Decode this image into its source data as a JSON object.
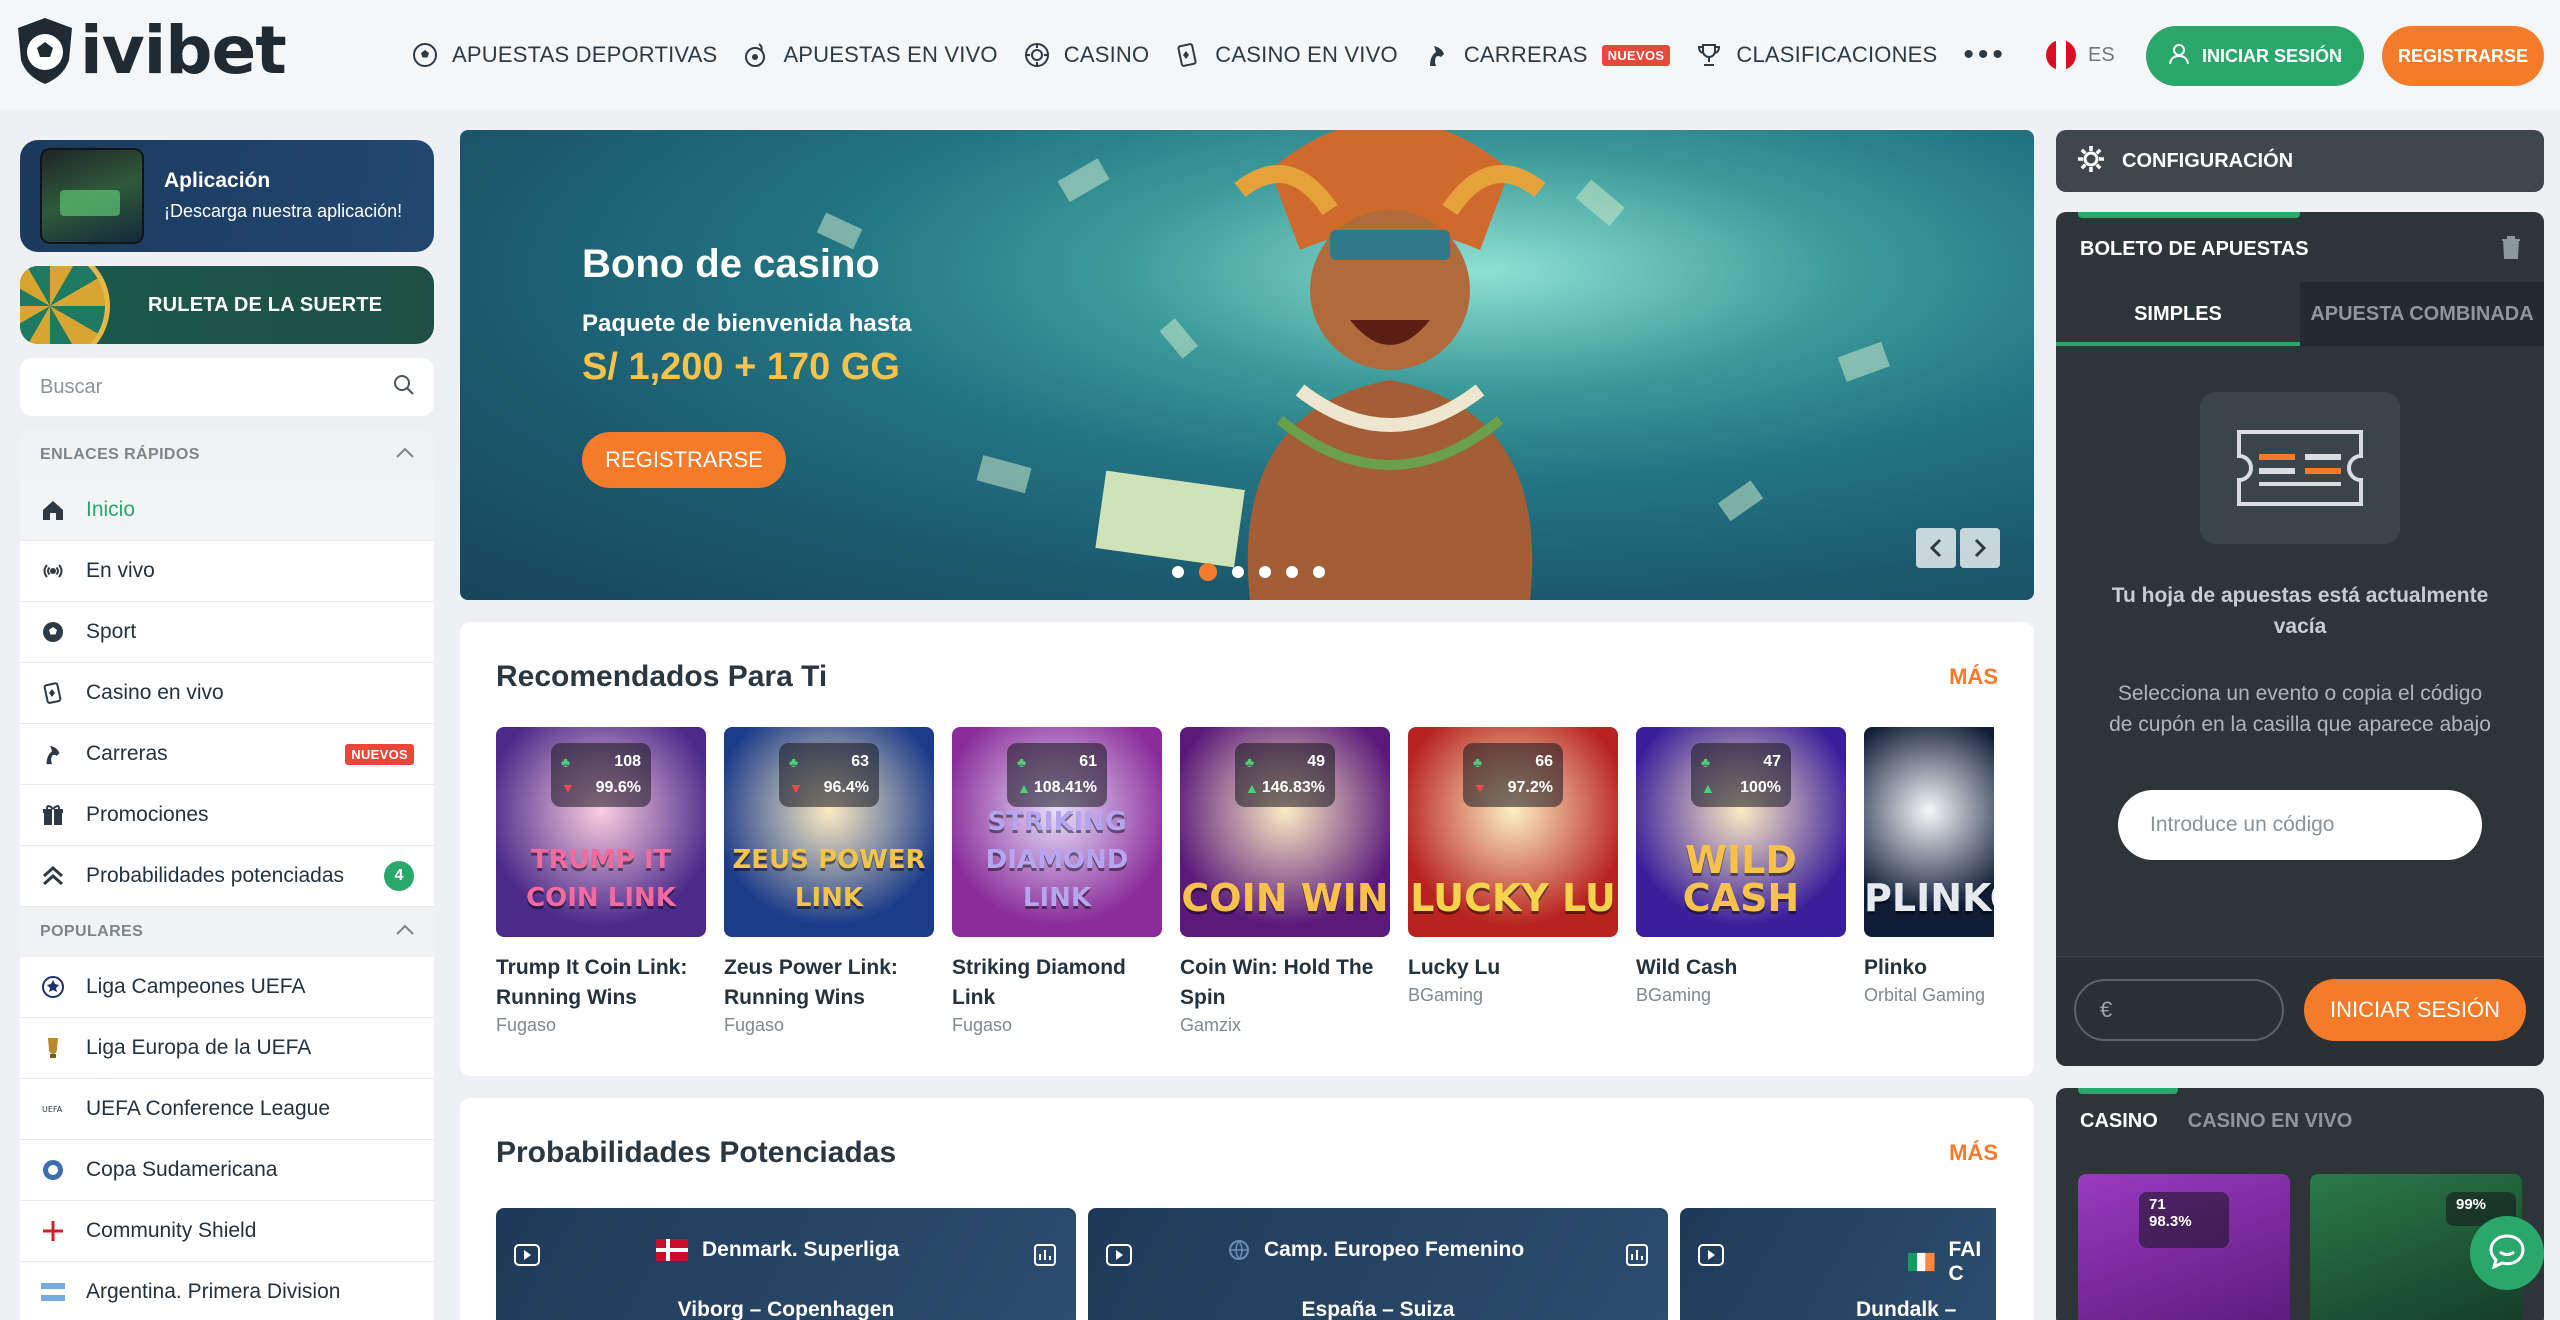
{
  "brand": {
    "name": "ivibet"
  },
  "colors": {
    "green": "#2aa86c",
    "orange": "#f47b29",
    "badge_red": "#e9473a"
  },
  "nav": {
    "items": [
      {
        "label": "APUESTAS DEPORTIVAS",
        "icon": "soccer-ball-icon"
      },
      {
        "label": "APUESTAS EN VIVO",
        "icon": "live-ball-icon"
      },
      {
        "label": "CASINO",
        "icon": "casino-chip-icon"
      },
      {
        "label": "CASINO EN VIVO",
        "icon": "live-casino-icon"
      },
      {
        "label": "CARRERAS",
        "icon": "horse-icon",
        "badge": "NUEVOS"
      },
      {
        "label": "CLASIFICACIONES",
        "icon": "trophy-icon"
      }
    ],
    "more": "•••"
  },
  "header": {
    "lang": "ES",
    "login": "INICIAR SESIÓN",
    "register": "REGISTRARSE"
  },
  "sidebar": {
    "app": {
      "title": "Aplicación",
      "subtitle": "¡Descarga nuestra aplicación!"
    },
    "wheel": "RULETA DE LA SUERTE",
    "search_placeholder": "Buscar",
    "quick_links": {
      "title": "ENLACES RÁPIDOS",
      "items": [
        {
          "label": "Inicio",
          "icon": "home-icon",
          "active": true
        },
        {
          "label": "En vivo",
          "icon": "live-signal-icon"
        },
        {
          "label": "Sport",
          "icon": "soccer-ball-icon"
        },
        {
          "label": "Casino en vivo",
          "icon": "live-casino-icon"
        },
        {
          "label": "Carreras",
          "icon": "horse-icon",
          "badge": "NUEVOS"
        },
        {
          "label": "Promociones",
          "icon": "gift-icon"
        },
        {
          "label": "Probabilidades potenciadas",
          "icon": "boost-icon",
          "count": "4"
        }
      ]
    },
    "popular": {
      "title": "POPULARES",
      "items": [
        {
          "label": "Liga Campeones UEFA",
          "icon": "champions-league-icon"
        },
        {
          "label": "Liga Europa de la UEFA",
          "icon": "europa-league-icon"
        },
        {
          "label": "UEFA Conference League",
          "icon": "conference-league-icon"
        },
        {
          "label": "Copa Sudamericana",
          "icon": "sudamericana-icon"
        },
        {
          "label": "Community Shield",
          "icon": "england-flag-icon"
        },
        {
          "label": "Argentina. Primera Division",
          "icon": "argentina-flag-icon"
        }
      ]
    }
  },
  "banner": {
    "title": "Bono de casino",
    "subtitle": "Paquete de bienvenida hasta",
    "amount": "S/ 1,200 + 170 GG",
    "button": "REGISTRARSE",
    "slides": 6,
    "active_slide": 2
  },
  "recommended": {
    "title": "Recomendados Para Ti",
    "more": "MÁS",
    "games": [
      {
        "name": "Trump It Coin Link: Running Wins",
        "provider": "Fugaso",
        "players": "108",
        "rtp": "99.6%",
        "rtp_dir": "down",
        "art": "TRUMP IT COIN LINK",
        "bg": "#4b2a8a",
        "accent": "#f26aa0"
      },
      {
        "name": "Zeus Power Link: Running Wins",
        "provider": "Fugaso",
        "players": "63",
        "rtp": "96.4%",
        "rtp_dir": "down",
        "art": "ZEUS POWER LINK",
        "bg": "#1c3c8a",
        "accent": "#f3c44a"
      },
      {
        "name": "Striking Diamond Link",
        "provider": "Fugaso",
        "players": "61",
        "rtp": "108.41%",
        "rtp_dir": "up",
        "art": "STRIKING DIAMOND LINK",
        "bg": "#8a2c9a",
        "accent": "#b6a6f0"
      },
      {
        "name": "Coin Win: Hold The Spin",
        "provider": "Gamzix",
        "players": "49",
        "rtp": "146.83%",
        "rtp_dir": "up",
        "art": "COIN WIN",
        "bg": "#5a1a7a",
        "accent": "#f6c24c"
      },
      {
        "name": "Lucky Lu",
        "provider": "BGaming",
        "players": "66",
        "rtp": "97.2%",
        "rtp_dir": "down",
        "art": "LUCKY LU",
        "bg": "#b8231f",
        "accent": "#f6d34c"
      },
      {
        "name": "Wild Cash",
        "provider": "BGaming",
        "players": "47",
        "rtp": "100%",
        "rtp_dir": "up",
        "art": "WILD CASH",
        "bg": "#3a1f9a",
        "accent": "#f6c24c"
      },
      {
        "name": "Plinko",
        "provider": "Orbital Gaming",
        "players": "",
        "rtp": "",
        "rtp_dir": "up",
        "art": "PLINKO",
        "bg": "#101c36",
        "accent": "#e6e9ee"
      }
    ]
  },
  "boosted": {
    "title": "Probabilidades Potenciadas",
    "more": "MÁS",
    "matches": [
      {
        "league": "Denmark. Superliga",
        "teams": "Viborg – Copenhagen",
        "flag": "denmark"
      },
      {
        "league": "Camp. Europeo Femenino",
        "teams": "España – Suiza",
        "flag": "globe"
      },
      {
        "league": "FAI C",
        "teams": "Dundalk – Slig",
        "flag": "ireland"
      }
    ]
  },
  "right": {
    "config": "CONFIGURACIÓN",
    "betslip": {
      "title": "BOLETO DE APUESTAS",
      "tabs": [
        "SIMPLES",
        "APUESTA COMBINADA"
      ],
      "empty_title": "Tu hoja de apuestas está actualmente vacía",
      "empty_sub": "Selecciona un evento o copia el código de cupón en la casilla que aparece abajo",
      "code_placeholder": "Introduce un código",
      "currency": "€",
      "login": "INICIAR SESIÓN"
    },
    "casino": {
      "tabs": [
        "CASINO",
        "CASINO EN VIVO"
      ],
      "games": [
        {
          "players": "71",
          "rtp": "98.3%",
          "bg": "#7a2aa0"
        },
        {
          "players": "",
          "rtp": "99%",
          "bg": "#1c5a3a"
        }
      ]
    }
  }
}
